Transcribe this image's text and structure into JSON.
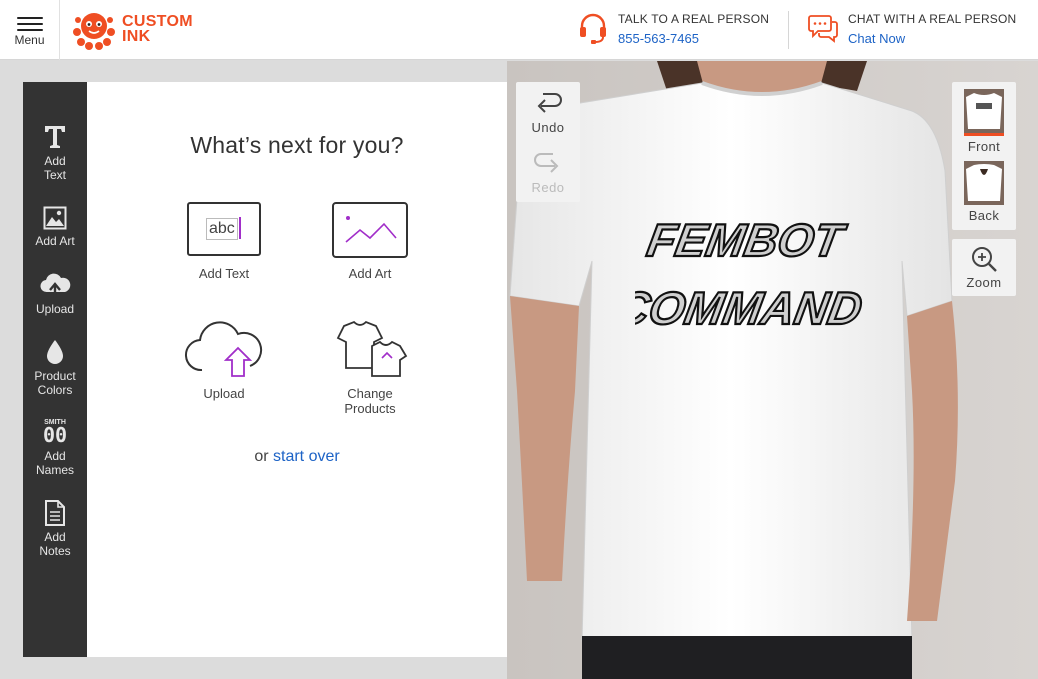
{
  "header": {
    "menu_label": "Menu",
    "logo_line1": "CUSTOM",
    "logo_line2": "INK",
    "phone": {
      "title": "TALK TO A REAL PERSON",
      "number": "855-563-7465"
    },
    "chat": {
      "title": "CHAT WITH A REAL PERSON",
      "link": "Chat Now"
    },
    "brand_color": "#ef4e23",
    "link_color": "#1d63c6"
  },
  "toolbar": {
    "items": [
      {
        "icon": "text-icon",
        "label_1": "Add",
        "label_2": "Text"
      },
      {
        "icon": "image-icon",
        "label_1": "Add Art",
        "label_2": ""
      },
      {
        "icon": "upload-cloud-icon",
        "label_1": "Upload",
        "label_2": ""
      },
      {
        "icon": "drop-icon",
        "label_1": "Product",
        "label_2": "Colors"
      },
      {
        "icon": "jersey-names-icon",
        "icon_caption": "SMITH",
        "icon_number": "00",
        "label_1": "Add",
        "label_2": "Names"
      },
      {
        "icon": "notes-icon",
        "label_1": "Add",
        "label_2": "Notes"
      }
    ]
  },
  "panel": {
    "title": "What’s next for you?",
    "options": [
      {
        "icon": "add-text-icon",
        "icon_text": "abc",
        "label_1": "Add Text",
        "label_2": ""
      },
      {
        "icon": "add-art-icon",
        "label_1": "Add Art",
        "label_2": ""
      },
      {
        "icon": "upload-icon",
        "label_1": "Upload",
        "label_2": ""
      },
      {
        "icon": "change-products-icon",
        "label_1": "Change",
        "label_2": "Products"
      }
    ],
    "start_over_prefix": "or",
    "start_over_link": "start over"
  },
  "canvas": {
    "undo": "Undo",
    "redo": "Redo",
    "views": [
      {
        "label": "Front",
        "active": true
      },
      {
        "label": "Back",
        "active": false
      }
    ],
    "zoom": "Zoom",
    "design_line1": "FEMBOT",
    "design_line2": "COMMAND",
    "shirt_color": "#ffffff"
  }
}
